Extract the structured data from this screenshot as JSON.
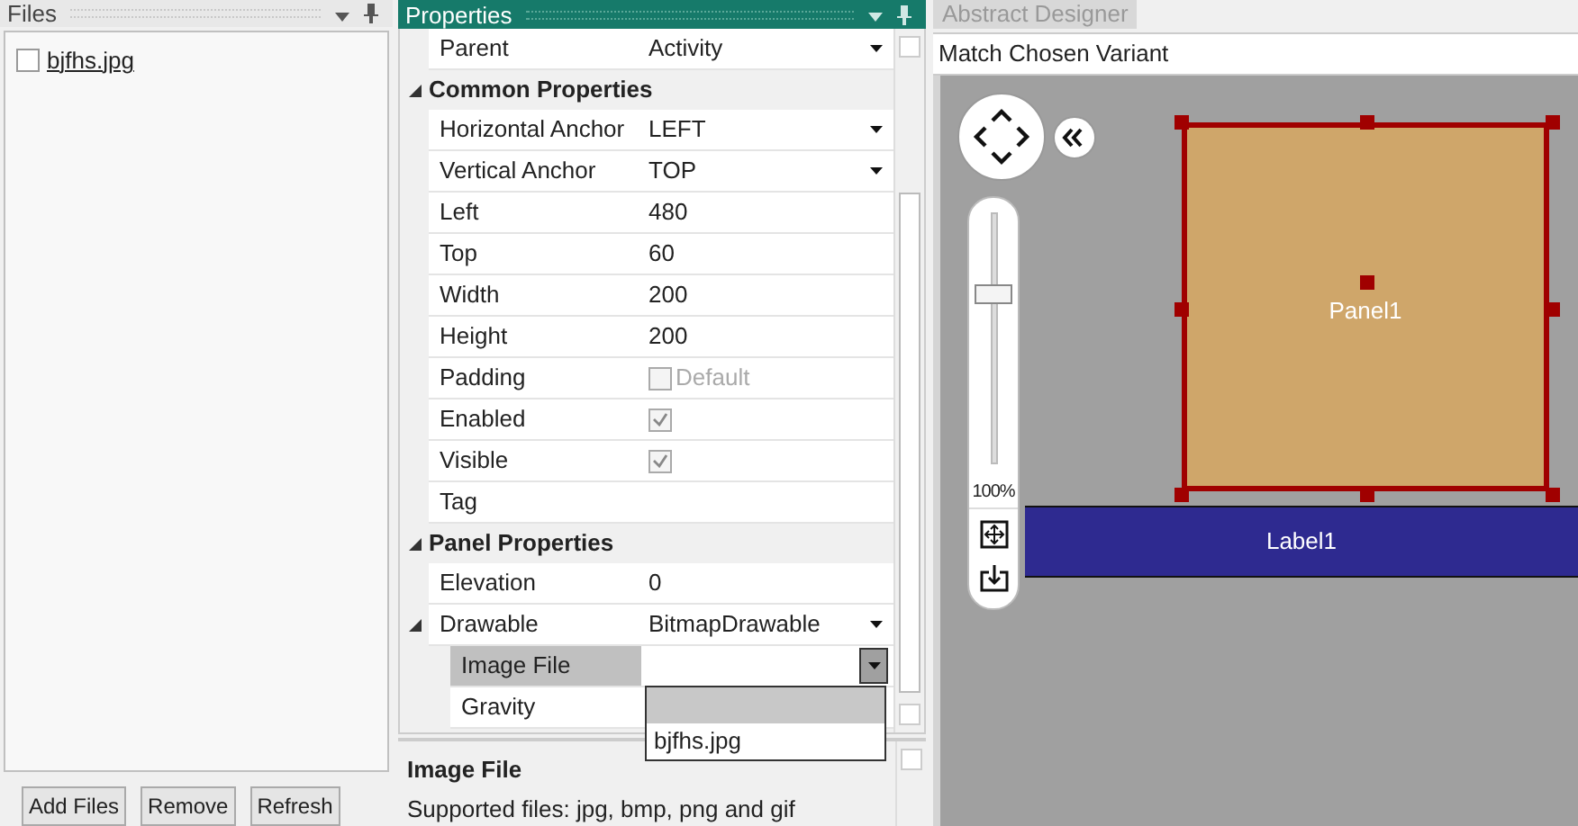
{
  "files_panel": {
    "title": "Files",
    "files": [
      {
        "name": "bjfhs.jpg",
        "checked": false
      }
    ],
    "buttons": [
      "Add Files",
      "Remove",
      "Refresh"
    ]
  },
  "properties_panel": {
    "title": "Properties",
    "rows": [
      {
        "kind": "dropdown",
        "name": "Parent",
        "value": "Activity"
      },
      {
        "kind": "category",
        "name": "Common Properties",
        "expanded": true
      },
      {
        "kind": "dropdown",
        "name": "Horizontal Anchor",
        "value": "LEFT"
      },
      {
        "kind": "dropdown",
        "name": "Vertical Anchor",
        "value": "TOP"
      },
      {
        "kind": "text",
        "name": "Left",
        "value": "480"
      },
      {
        "kind": "text",
        "name": "Top",
        "value": "60"
      },
      {
        "kind": "text",
        "name": "Width",
        "value": "200"
      },
      {
        "kind": "text",
        "name": "Height",
        "value": "200"
      },
      {
        "kind": "checkbox",
        "name": "Padding",
        "checked": false,
        "disabled": true,
        "value": "Default"
      },
      {
        "kind": "checkbox",
        "name": "Enabled",
        "checked": true,
        "disabled": true
      },
      {
        "kind": "checkbox",
        "name": "Visible",
        "checked": true,
        "disabled": true
      },
      {
        "kind": "text",
        "name": "Tag"
      },
      {
        "kind": "category",
        "name": "Panel Properties",
        "expanded": true
      },
      {
        "kind": "text",
        "name": "Elevation",
        "value": "0"
      },
      {
        "kind": "dropdown",
        "name": "Drawable",
        "value": "BitmapDrawable",
        "expanded": true,
        "children": [
          {
            "kind": "dropdown",
            "name": "Image File",
            "selected": true,
            "open": true,
            "options": [
              "bjfhs.jpg"
            ]
          },
          {
            "kind": "text",
            "name": "Gravity",
            "selected": false
          }
        ]
      }
    ],
    "description": {
      "title": "Image File",
      "text": "Supported files: jpg, bmp, png and gif"
    }
  },
  "designer": {
    "tab": "Abstract Designer",
    "variant": "Match Chosen Variant",
    "zoom": {
      "level": 0.68,
      "reading": "100%"
    },
    "views": [
      {
        "kind": "panel",
        "label": "Panel1",
        "selected": true
      },
      {
        "kind": "label",
        "label": "Label1",
        "selected": false
      }
    ]
  }
}
